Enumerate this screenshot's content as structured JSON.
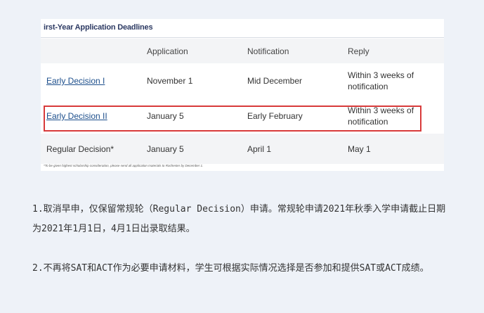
{
  "table": {
    "title": "irst-Year Application Deadlines",
    "headers": [
      "",
      "Application",
      "Notification",
      "Reply"
    ],
    "rows": [
      {
        "plan": "Early Decision I",
        "application": "November 1",
        "notification": "Mid December",
        "reply": "Within 3 weeks of notification"
      },
      {
        "plan": "Early Decision II",
        "application": "January 5",
        "notification": "Early February",
        "reply": "Within 3 weeks of notification"
      },
      {
        "plan": "Regular Decision*",
        "application": "January 5",
        "notification": "April 1",
        "reply": "May 1"
      }
    ],
    "footnote": "*To be given highest scholarship consideration, please send all application materials to Rochester by December 1.",
    "highlight_color": "#d83a3a",
    "link_color": "#1d4f8c"
  },
  "paragraphs": [
    "1.取消早申，仅保留常规轮（Regular Decision）申请。常规轮申请2021年秋季入学申请截止日期为2021年1月1日，4月1日出录取结果。",
    "2.不再将SAT和ACT作为必要申请材料，学生可根据实际情况选择是否参加和提供SAT或ACT成绩。"
  ]
}
